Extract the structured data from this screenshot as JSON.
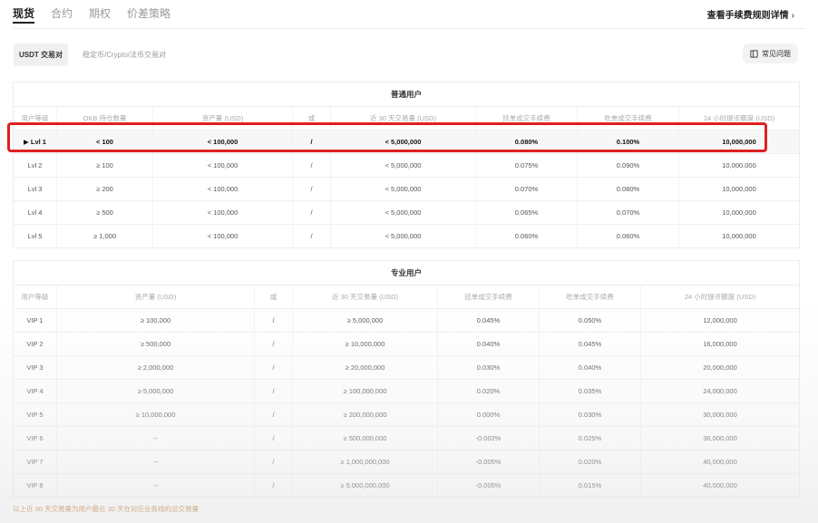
{
  "tabs": [
    "现货",
    "合约",
    "期权",
    "价差策略"
  ],
  "fee_link": "查看手续费规则详情",
  "subtabs": [
    "USDT 交易对",
    "稳定币/Crypto/法币交易对"
  ],
  "faq": "常见问题",
  "standard": {
    "title": "普通用户",
    "headers": [
      "用户等级",
      "OKB 持仓数量",
      "资产量 (USD)",
      "或",
      "近 30 天交易量 (USD)",
      "挂单成交手续费",
      "吃单成交手续费",
      "24 小时提币额度 (USD)"
    ],
    "rows": [
      [
        "▶ Lvl 1",
        "< 100",
        "< 100,000",
        "/",
        "< 5,000,000",
        "0.080%",
        "0.100%",
        "10,000,000"
      ],
      [
        "Lvl 2",
        "≥ 100",
        "< 100,000",
        "/",
        "< 5,000,000",
        "0.075%",
        "0.090%",
        "10,000,000"
      ],
      [
        "Lvl 3",
        "≥ 200",
        "< 100,000",
        "/",
        "< 5,000,000",
        "0.070%",
        "0.080%",
        "10,000,000"
      ],
      [
        "Lvl 4",
        "≥ 500",
        "< 100,000",
        "/",
        "< 5,000,000",
        "0.065%",
        "0.070%",
        "10,000,000"
      ],
      [
        "Lvl 5",
        "≥ 1,000",
        "< 100,000",
        "/",
        "< 5,000,000",
        "0.060%",
        "0.060%",
        "10,000,000"
      ]
    ]
  },
  "vip": {
    "title": "专业用户",
    "headers": [
      "用户等级",
      "资产量 (USD)",
      "或",
      "近 30 天交易量 (USD)",
      "挂单成交手续费",
      "吃单成交手续费",
      "24 小时提币额度 (USD)"
    ],
    "rows": [
      [
        "VIP 1",
        "≥ 100,000",
        "/",
        "≥ 5,000,000",
        "0.045%",
        "0.050%",
        "12,000,000"
      ],
      [
        "VIP 2",
        "≥ 500,000",
        "/",
        "≥ 10,000,000",
        "0.040%",
        "0.045%",
        "16,000,000"
      ],
      [
        "VIP 3",
        "≥ 2,000,000",
        "/",
        "≥ 20,000,000",
        "0.030%",
        "0.040%",
        "20,000,000"
      ],
      [
        "VIP 4",
        "≥ 5,000,000",
        "/",
        "≥ 100,000,000",
        "0.020%",
        "0.035%",
        "24,000,000"
      ],
      [
        "VIP 5",
        "≥ 10,000,000",
        "/",
        "≥ 200,000,000",
        "0.000%",
        "0.030%",
        "30,000,000"
      ],
      [
        "VIP 6",
        "--",
        "/",
        "≥ 500,000,000",
        "-0.002%",
        "0.025%",
        "36,000,000"
      ],
      [
        "VIP 7",
        "--",
        "/",
        "≥ 1,000,000,000",
        "-0.005%",
        "0.020%",
        "40,000,000"
      ],
      [
        "VIP 8",
        "--",
        "/",
        "≥ 5,000,000,000",
        "-0.005%",
        "0.015%",
        "40,000,000"
      ]
    ]
  },
  "footnote": "以上近 30 天交易量为用户最近 30 天在对应业务线的总交易量",
  "colors": {
    "highlight": "#e02020",
    "footnote": "#c07a3a"
  }
}
